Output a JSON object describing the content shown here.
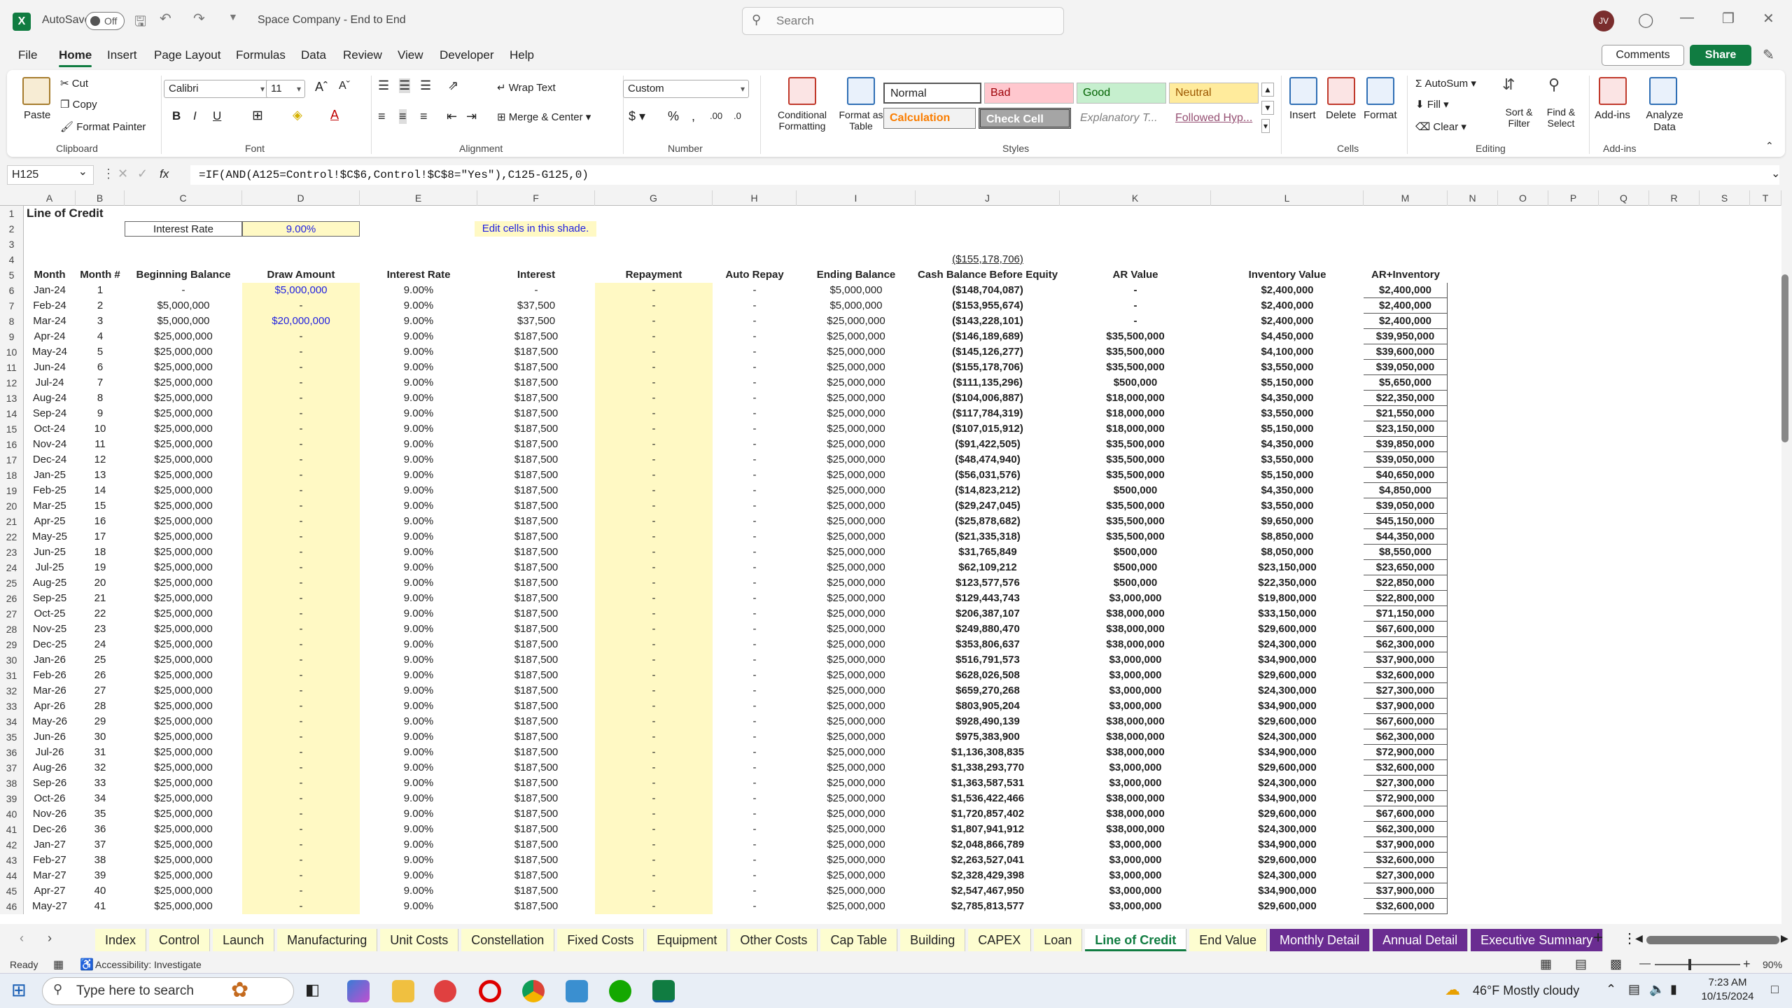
{
  "titlebar": {
    "autosave_label": "AutoSave",
    "autosave_state": "Off",
    "doc_title": "Space Company - End to End",
    "search_placeholder": "Search",
    "user_initials": "JV"
  },
  "menu": {
    "items": [
      "File",
      "Home",
      "Insert",
      "Page Layout",
      "Formulas",
      "Data",
      "Review",
      "View",
      "Developer",
      "Help"
    ],
    "comments": "Comments",
    "share": "Share"
  },
  "ribbon": {
    "clipboard": {
      "paste": "Paste",
      "cut": "Cut",
      "copy": "Copy",
      "format_painter": "Format Painter",
      "label": "Clipboard"
    },
    "font": {
      "family": "Calibri",
      "size": "11",
      "label": "Font"
    },
    "alignment": {
      "wrap": "Wrap Text",
      "merge": "Merge & Center",
      "label": "Alignment"
    },
    "number": {
      "format": "Custom",
      "label": "Number"
    },
    "styles": {
      "conditional": "Conditional Formatting",
      "format_table": "Format as Table",
      "normal": "Normal",
      "bad": "Bad",
      "good": "Good",
      "neutral": "Neutral",
      "calculation": "Calculation",
      "check": "Check Cell",
      "explanatory": "Explanatory T...",
      "followed": "Followed Hyp...",
      "label": "Styles"
    },
    "cells": {
      "insert": "Insert",
      "delete": "Delete",
      "format": "Format",
      "label": "Cells"
    },
    "editing": {
      "autosum": "AutoSum",
      "fill": "Fill",
      "clear": "Clear",
      "sort": "Sort & Filter",
      "find": "Find & Select",
      "label": "Editing"
    },
    "addins": {
      "addins": "Add-ins",
      "analyze": "Analyze Data",
      "label": "Add-ins"
    }
  },
  "formula_bar": {
    "name_box": "H125",
    "fx": "fx",
    "formula": "=IF(AND(A125=Control!$C$6,Control!$C$8=\"Yes\"),C125-G125,0)"
  },
  "columns": [
    "A",
    "B",
    "C",
    "D",
    "E",
    "F",
    "G",
    "H",
    "I",
    "J",
    "K",
    "L",
    "M",
    "N",
    "O",
    "P",
    "Q",
    "R",
    "S",
    "T"
  ],
  "sheet": {
    "title": "Line of Credit",
    "interest_label": "Interest Rate",
    "interest_value": "9.00%",
    "edit_note": "Edit cells in this shade.",
    "j4": "($155,178,706)",
    "headers": [
      "Month",
      "Month #",
      "Beginning Balance",
      "Draw Amount",
      "Interest Rate",
      "Interest",
      "Repayment",
      "Auto Repay",
      "Ending Balance",
      "Cash Balance Before Equity",
      "AR Value",
      "Inventory Value",
      "AR+Inventory"
    ],
    "rows": [
      [
        "Jan-24",
        "1",
        "-",
        "$5,000,000",
        "9.00%",
        "-",
        "-",
        "-",
        "$5,000,000",
        "($148,704,087)",
        "-",
        "$2,400,000",
        "$2,400,000"
      ],
      [
        "Feb-24",
        "2",
        "$5,000,000",
        "-",
        "9.00%",
        "$37,500",
        "-",
        "-",
        "$5,000,000",
        "($153,955,674)",
        "-",
        "$2,400,000",
        "$2,400,000"
      ],
      [
        "Mar-24",
        "3",
        "$5,000,000",
        "$20,000,000",
        "9.00%",
        "$37,500",
        "-",
        "-",
        "$25,000,000",
        "($143,228,101)",
        "-",
        "$2,400,000",
        "$2,400,000"
      ],
      [
        "Apr-24",
        "4",
        "$25,000,000",
        "-",
        "9.00%",
        "$187,500",
        "-",
        "-",
        "$25,000,000",
        "($146,189,689)",
        "$35,500,000",
        "$4,450,000",
        "$39,950,000"
      ],
      [
        "May-24",
        "5",
        "$25,000,000",
        "-",
        "9.00%",
        "$187,500",
        "-",
        "-",
        "$25,000,000",
        "($145,126,277)",
        "$35,500,000",
        "$4,100,000",
        "$39,600,000"
      ],
      [
        "Jun-24",
        "6",
        "$25,000,000",
        "-",
        "9.00%",
        "$187,500",
        "-",
        "-",
        "$25,000,000",
        "($155,178,706)",
        "$35,500,000",
        "$3,550,000",
        "$39,050,000"
      ],
      [
        "Jul-24",
        "7",
        "$25,000,000",
        "-",
        "9.00%",
        "$187,500",
        "-",
        "-",
        "$25,000,000",
        "($111,135,296)",
        "$500,000",
        "$5,150,000",
        "$5,650,000"
      ],
      [
        "Aug-24",
        "8",
        "$25,000,000",
        "-",
        "9.00%",
        "$187,500",
        "-",
        "-",
        "$25,000,000",
        "($104,006,887)",
        "$18,000,000",
        "$4,350,000",
        "$22,350,000"
      ],
      [
        "Sep-24",
        "9",
        "$25,000,000",
        "-",
        "9.00%",
        "$187,500",
        "-",
        "-",
        "$25,000,000",
        "($117,784,319)",
        "$18,000,000",
        "$3,550,000",
        "$21,550,000"
      ],
      [
        "Oct-24",
        "10",
        "$25,000,000",
        "-",
        "9.00%",
        "$187,500",
        "-",
        "-",
        "$25,000,000",
        "($107,015,912)",
        "$18,000,000",
        "$5,150,000",
        "$23,150,000"
      ],
      [
        "Nov-24",
        "11",
        "$25,000,000",
        "-",
        "9.00%",
        "$187,500",
        "-",
        "-",
        "$25,000,000",
        "($91,422,505)",
        "$35,500,000",
        "$4,350,000",
        "$39,850,000"
      ],
      [
        "Dec-24",
        "12",
        "$25,000,000",
        "-",
        "9.00%",
        "$187,500",
        "-",
        "-",
        "$25,000,000",
        "($48,474,940)",
        "$35,500,000",
        "$3,550,000",
        "$39,050,000"
      ],
      [
        "Jan-25",
        "13",
        "$25,000,000",
        "-",
        "9.00%",
        "$187,500",
        "-",
        "-",
        "$25,000,000",
        "($56,031,576)",
        "$35,500,000",
        "$5,150,000",
        "$40,650,000"
      ],
      [
        "Feb-25",
        "14",
        "$25,000,000",
        "-",
        "9.00%",
        "$187,500",
        "-",
        "-",
        "$25,000,000",
        "($14,823,212)",
        "$500,000",
        "$4,350,000",
        "$4,850,000"
      ],
      [
        "Mar-25",
        "15",
        "$25,000,000",
        "-",
        "9.00%",
        "$187,500",
        "-",
        "-",
        "$25,000,000",
        "($29,247,045)",
        "$35,500,000",
        "$3,550,000",
        "$39,050,000"
      ],
      [
        "Apr-25",
        "16",
        "$25,000,000",
        "-",
        "9.00%",
        "$187,500",
        "-",
        "-",
        "$25,000,000",
        "($25,878,682)",
        "$35,500,000",
        "$9,650,000",
        "$45,150,000"
      ],
      [
        "May-25",
        "17",
        "$25,000,000",
        "-",
        "9.00%",
        "$187,500",
        "-",
        "-",
        "$25,000,000",
        "($21,335,318)",
        "$35,500,000",
        "$8,850,000",
        "$44,350,000"
      ],
      [
        "Jun-25",
        "18",
        "$25,000,000",
        "-",
        "9.00%",
        "$187,500",
        "-",
        "-",
        "$25,000,000",
        "$31,765,849",
        "$500,000",
        "$8,050,000",
        "$8,550,000"
      ],
      [
        "Jul-25",
        "19",
        "$25,000,000",
        "-",
        "9.00%",
        "$187,500",
        "-",
        "-",
        "$25,000,000",
        "$62,109,212",
        "$500,000",
        "$23,150,000",
        "$23,650,000"
      ],
      [
        "Aug-25",
        "20",
        "$25,000,000",
        "-",
        "9.00%",
        "$187,500",
        "-",
        "-",
        "$25,000,000",
        "$123,577,576",
        "$500,000",
        "$22,350,000",
        "$22,850,000"
      ],
      [
        "Sep-25",
        "21",
        "$25,000,000",
        "-",
        "9.00%",
        "$187,500",
        "-",
        "-",
        "$25,000,000",
        "$129,443,743",
        "$3,000,000",
        "$19,800,000",
        "$22,800,000"
      ],
      [
        "Oct-25",
        "22",
        "$25,000,000",
        "-",
        "9.00%",
        "$187,500",
        "-",
        "-",
        "$25,000,000",
        "$206,387,107",
        "$38,000,000",
        "$33,150,000",
        "$71,150,000"
      ],
      [
        "Nov-25",
        "23",
        "$25,000,000",
        "-",
        "9.00%",
        "$187,500",
        "-",
        "-",
        "$25,000,000",
        "$249,880,470",
        "$38,000,000",
        "$29,600,000",
        "$67,600,000"
      ],
      [
        "Dec-25",
        "24",
        "$25,000,000",
        "-",
        "9.00%",
        "$187,500",
        "-",
        "-",
        "$25,000,000",
        "$353,806,637",
        "$38,000,000",
        "$24,300,000",
        "$62,300,000"
      ],
      [
        "Jan-26",
        "25",
        "$25,000,000",
        "-",
        "9.00%",
        "$187,500",
        "-",
        "-",
        "$25,000,000",
        "$516,791,573",
        "$3,000,000",
        "$34,900,000",
        "$37,900,000"
      ],
      [
        "Feb-26",
        "26",
        "$25,000,000",
        "-",
        "9.00%",
        "$187,500",
        "-",
        "-",
        "$25,000,000",
        "$628,026,508",
        "$3,000,000",
        "$29,600,000",
        "$32,600,000"
      ],
      [
        "Mar-26",
        "27",
        "$25,000,000",
        "-",
        "9.00%",
        "$187,500",
        "-",
        "-",
        "$25,000,000",
        "$659,270,268",
        "$3,000,000",
        "$24,300,000",
        "$27,300,000"
      ],
      [
        "Apr-26",
        "28",
        "$25,000,000",
        "-",
        "9.00%",
        "$187,500",
        "-",
        "-",
        "$25,000,000",
        "$803,905,204",
        "$3,000,000",
        "$34,900,000",
        "$37,900,000"
      ],
      [
        "May-26",
        "29",
        "$25,000,000",
        "-",
        "9.00%",
        "$187,500",
        "-",
        "-",
        "$25,000,000",
        "$928,490,139",
        "$38,000,000",
        "$29,600,000",
        "$67,600,000"
      ],
      [
        "Jun-26",
        "30",
        "$25,000,000",
        "-",
        "9.00%",
        "$187,500",
        "-",
        "-",
        "$25,000,000",
        "$975,383,900",
        "$38,000,000",
        "$24,300,000",
        "$62,300,000"
      ],
      [
        "Jul-26",
        "31",
        "$25,000,000",
        "-",
        "9.00%",
        "$187,500",
        "-",
        "-",
        "$25,000,000",
        "$1,136,308,835",
        "$38,000,000",
        "$34,900,000",
        "$72,900,000"
      ],
      [
        "Aug-26",
        "32",
        "$25,000,000",
        "-",
        "9.00%",
        "$187,500",
        "-",
        "-",
        "$25,000,000",
        "$1,338,293,770",
        "$3,000,000",
        "$29,600,000",
        "$32,600,000"
      ],
      [
        "Sep-26",
        "33",
        "$25,000,000",
        "-",
        "9.00%",
        "$187,500",
        "-",
        "-",
        "$25,000,000",
        "$1,363,587,531",
        "$3,000,000",
        "$24,300,000",
        "$27,300,000"
      ],
      [
        "Oct-26",
        "34",
        "$25,000,000",
        "-",
        "9.00%",
        "$187,500",
        "-",
        "-",
        "$25,000,000",
        "$1,536,422,466",
        "$38,000,000",
        "$34,900,000",
        "$72,900,000"
      ],
      [
        "Nov-26",
        "35",
        "$25,000,000",
        "-",
        "9.00%",
        "$187,500",
        "-",
        "-",
        "$25,000,000",
        "$1,720,857,402",
        "$38,000,000",
        "$29,600,000",
        "$67,600,000"
      ],
      [
        "Dec-26",
        "36",
        "$25,000,000",
        "-",
        "9.00%",
        "$187,500",
        "-",
        "-",
        "$25,000,000",
        "$1,807,941,912",
        "$38,000,000",
        "$24,300,000",
        "$62,300,000"
      ],
      [
        "Jan-27",
        "37",
        "$25,000,000",
        "-",
        "9.00%",
        "$187,500",
        "-",
        "-",
        "$25,000,000",
        "$2,048,866,789",
        "$3,000,000",
        "$34,900,000",
        "$37,900,000"
      ],
      [
        "Feb-27",
        "38",
        "$25,000,000",
        "-",
        "9.00%",
        "$187,500",
        "-",
        "-",
        "$25,000,000",
        "$2,263,527,041",
        "$3,000,000",
        "$29,600,000",
        "$32,600,000"
      ],
      [
        "Mar-27",
        "39",
        "$25,000,000",
        "-",
        "9.00%",
        "$187,500",
        "-",
        "-",
        "$25,000,000",
        "$2,328,429,398",
        "$3,000,000",
        "$24,300,000",
        "$27,300,000"
      ],
      [
        "Apr-27",
        "40",
        "$25,000,000",
        "-",
        "9.00%",
        "$187,500",
        "-",
        "-",
        "$25,000,000",
        "$2,547,467,950",
        "$3,000,000",
        "$34,900,000",
        "$37,900,000"
      ],
      [
        "May-27",
        "41",
        "$25,000,000",
        "-",
        "9.00%",
        "$187,500",
        "-",
        "-",
        "$25,000,000",
        "$2,785,813,577",
        "$3,000,000",
        "$29,600,000",
        "$32,600,000"
      ]
    ]
  },
  "sheet_tabs": {
    "items": [
      "Index",
      "Control",
      "Launch",
      "Manufacturing",
      "Unit Costs",
      "Constellation",
      "Fixed Costs",
      "Equipment",
      "Other Costs",
      "Cap Table",
      "Building",
      "CAPEX",
      "Loan",
      "Line of Credit",
      "End Value",
      "Monthly Detail",
      "Annual Detail",
      "Executive Summary"
    ],
    "active": "Line of Credit"
  },
  "status": {
    "ready": "Ready",
    "accessibility": "Accessibility: Investigate",
    "zoom": "90%"
  },
  "taskbar": {
    "search_placeholder": "Type here to search",
    "weather": "46°F  Mostly cloudy",
    "time": "7:23 AM",
    "date": "10/15/2024"
  },
  "colors": {
    "excel_green": "#107c41",
    "input_shade": "#fff9c4",
    "purple_tab": "#6a2c91"
  }
}
